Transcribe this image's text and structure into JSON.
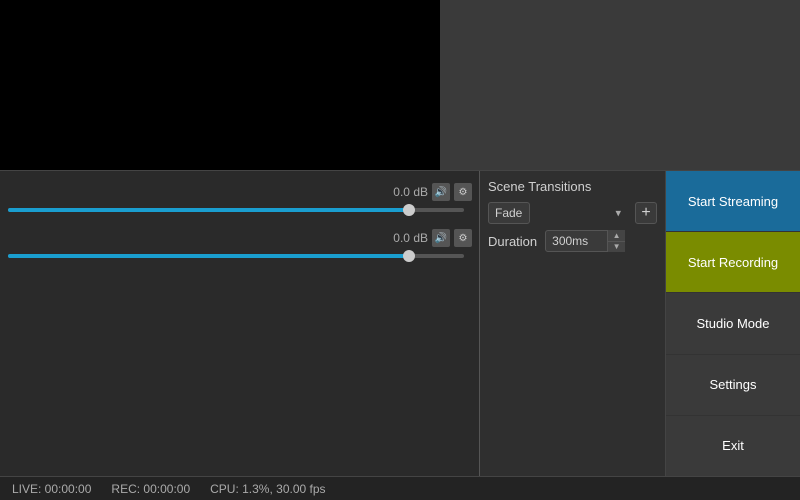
{
  "preview": {
    "main_bg": "#000000",
    "right_bg": "#3a3a3a"
  },
  "audio": {
    "channel1": {
      "db": "0.0 dB",
      "fill_pct": 88,
      "thumb_pct": 88
    },
    "channel2": {
      "db": "0.0 dB",
      "fill_pct": 88,
      "thumb_pct": 88
    }
  },
  "scene_transitions": {
    "label": "Scene Transitions",
    "fade_option": "Fade",
    "duration_label": "Duration",
    "duration_value": "300ms"
  },
  "buttons": {
    "start_streaming": "Start Streaming",
    "start_recording": "Start Recording",
    "studio_mode": "Studio Mode",
    "settings": "Settings",
    "exit": "Exit"
  },
  "status_bar": {
    "live": "LIVE: 00:00:00",
    "rec": "REC: 00:00:00",
    "cpu": "CPU: 1.3%, 30.00 fps"
  },
  "icons": {
    "speaker": "🔊",
    "gear": "⚙",
    "plus": "+",
    "spin_up": "▲",
    "spin_down": "▼",
    "dropdown_arrow": "▾"
  }
}
